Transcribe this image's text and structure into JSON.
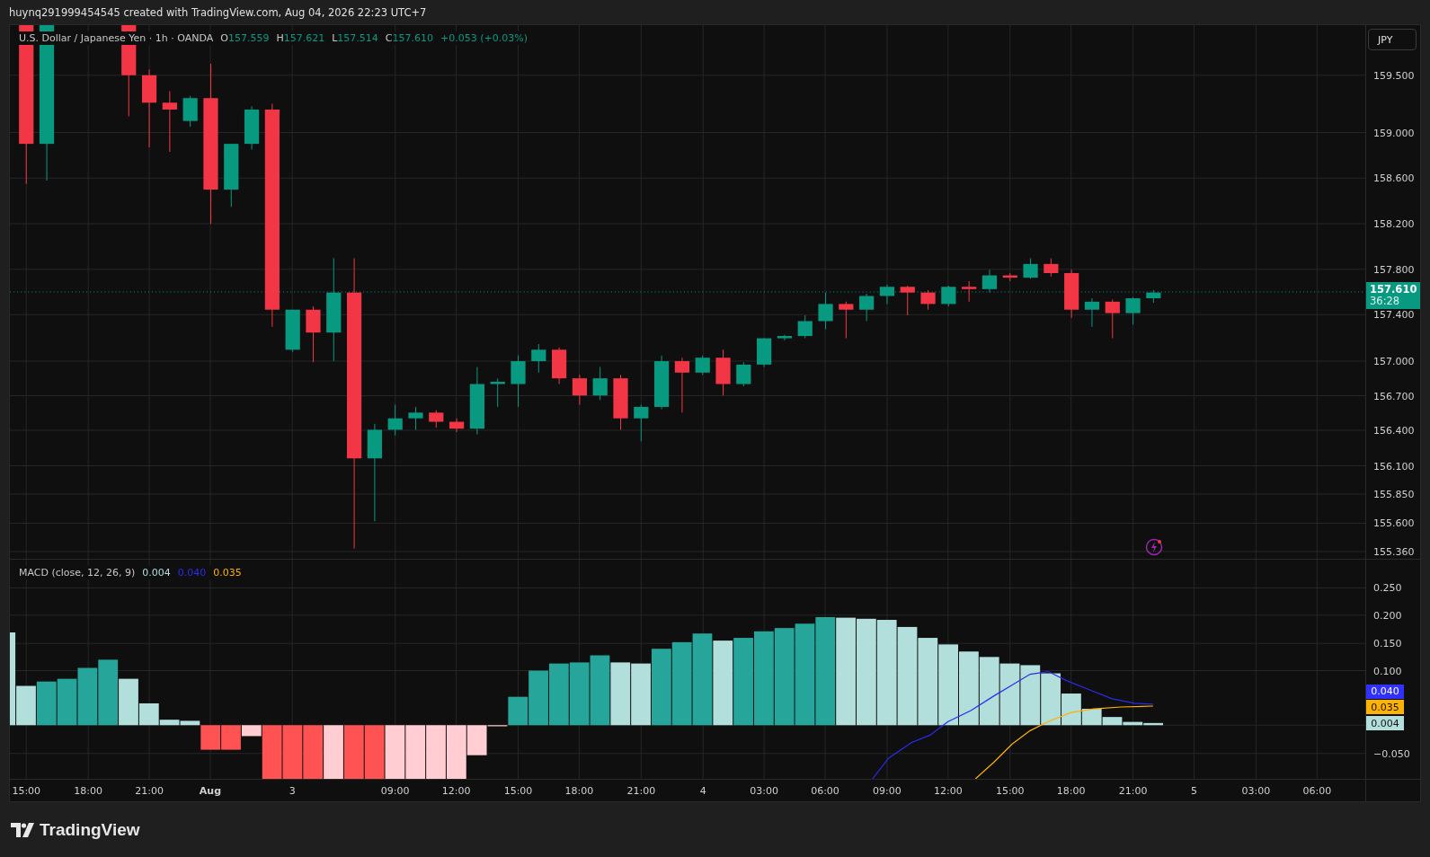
{
  "header": {
    "text": "huynq291999454545 created with TradingView.com, Aug 04, 2026 22:23 UTC+7"
  },
  "legend": {
    "symbol": "U.S. Dollar / Japanese Yen · 1h · OANDA",
    "ohlc": [
      {
        "key": "O",
        "value": "157.559"
      },
      {
        "key": "H",
        "value": "157.621"
      },
      {
        "key": "L",
        "value": "157.514"
      },
      {
        "key": "C",
        "value": "157.610"
      }
    ],
    "change": "+0.053 (+0.03%)"
  },
  "currency_button": "JPY",
  "price_axis": [
    "159.500",
    "159.000",
    "158.600",
    "158.200",
    "157.800",
    "157.400",
    "157.000",
    "156.700",
    "156.400",
    "156.100",
    "155.850",
    "155.600",
    "155.360"
  ],
  "last_price": {
    "price": "157.610",
    "countdown": "36:28"
  },
  "macd": {
    "label": "MACD (close, 12, 26, 9)",
    "values": [
      {
        "value": "0.004",
        "color": "#b2dfdb"
      },
      {
        "value": "0.040",
        "color": "#2b2bf0"
      },
      {
        "value": "0.035",
        "color": "#ffb000"
      }
    ],
    "axis": [
      "0.250",
      "0.200",
      "0.150",
      "0.100",
      "−0.050"
    ],
    "badges": [
      {
        "value": "0.040",
        "color": "#3030ff"
      },
      {
        "value": "0.035",
        "color": "#ffb300"
      },
      {
        "value": "0.004",
        "color": "#b2dfdb"
      }
    ]
  },
  "time_axis": [
    "15:00",
    "18:00",
    "21:00",
    "Aug",
    "3",
    "09:00",
    "12:00",
    "15:00",
    "18:00",
    "21:00",
    "4",
    "03:00",
    "06:00",
    "09:00",
    "12:00",
    "15:00",
    "18:00",
    "21:00",
    "5",
    "03:00",
    "06:00"
  ],
  "footer": {
    "brand": "TradingView"
  }
}
